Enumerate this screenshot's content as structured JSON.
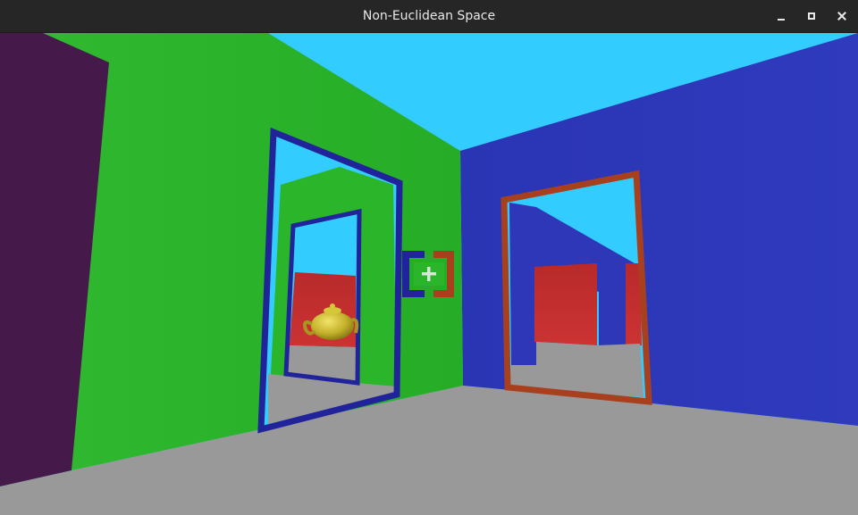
{
  "window": {
    "title": "Non-Euclidean Space"
  },
  "controls": {
    "minimize_icon": "minimize-icon",
    "maximize_icon": "maximize-icon",
    "close_icon": "close-icon"
  },
  "scene": {
    "colors": {
      "ceiling": "#33ccff",
      "floor": "#999999",
      "left_wall": "#2bb52b",
      "right_wall": "#2d37b8",
      "far_left_wall": "#451a4b",
      "portal_blue_frame": "#21239a",
      "portal_orange_frame": "#a8401e",
      "red_room_wall": "#c02d2d",
      "teapot": "#c9b92a"
    },
    "objects": [
      "blue-portal",
      "orange-portal",
      "golden-teapot",
      "crosshair"
    ]
  }
}
